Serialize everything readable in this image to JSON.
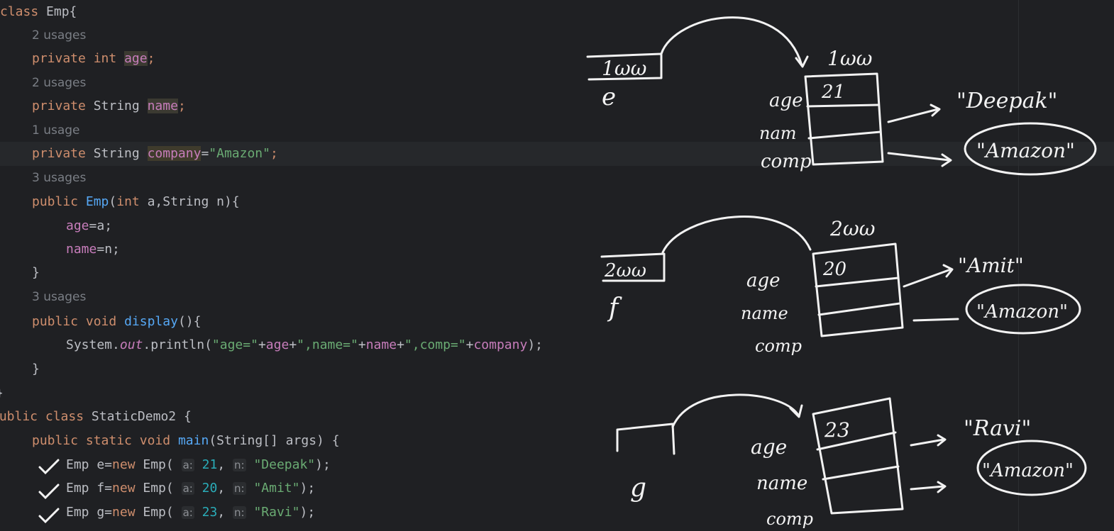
{
  "code": {
    "l1": {
      "kw": "class",
      "name": "Emp{"
    },
    "hints": {
      "u2a": "2 usages",
      "u2b": "2 usages",
      "u1": "1 usage",
      "u3a": "3 usages",
      "u3b": "3 usages"
    },
    "l3": {
      "kw1": "private",
      "kw2": "int",
      "field": "age",
      "end": ";"
    },
    "l5": {
      "kw1": "private",
      "type": "String",
      "field": "name",
      "end": ";"
    },
    "l7": {
      "kw1": "private",
      "type": "String",
      "field": "company",
      "eq": "=",
      "str": "\"Amazon\"",
      "end": ";"
    },
    "l9": {
      "kw1": "public",
      "fn": "Emp",
      "p1": "(",
      "kw2": "int",
      "p2": " a,String n){"
    },
    "l10": {
      "field": "age",
      "rest": "=a;"
    },
    "l11": {
      "field": "name",
      "rest": "=n;"
    },
    "l12": "}",
    "l14": {
      "kw1": "public",
      "kw2": "void",
      "fn": "display",
      "rest": "(){"
    },
    "l15": {
      "a": "System.",
      "out": "out",
      "b": ".println(",
      "s1": "\"age=\"",
      "op1": "+",
      "f1": "age",
      "op2": "+",
      "s2": "\",name=\"",
      "op3": "+",
      "f2": "name",
      "op4": "+",
      "s3": "\",comp=\"",
      "op5": "+",
      "f3": "company",
      "end": ");"
    },
    "l16": "}",
    "l17": "}",
    "l18": {
      "kw1": "public",
      "kw2": "class",
      "name": "StaticDemo2 {"
    },
    "l19": {
      "kw1": "public",
      "kw2": "static",
      "kw3": "void",
      "fn": "main",
      "rest": "(String[] args) {"
    },
    "l20": {
      "a": "Emp e=",
      "kw": "new",
      "b": " Emp( ",
      "pa": "a:",
      "n1": "21",
      ",": ", ",
      "pn": "n:",
      "s": "\"Deepak\"",
      "end": ");"
    },
    "l21": {
      "a": "Emp f=",
      "kw": "new",
      "b": " Emp( ",
      "pa": "a:",
      "n1": "20",
      ",": ", ",
      "pn": "n:",
      "s": "\"Amit\"",
      "end": ");"
    },
    "l22": {
      "a": "Emp g=",
      "kw": "new",
      "b": " Emp( ",
      "pa": "a:",
      "n1": "23",
      ",": ", ",
      "pn": "n:",
      "s": "\"Ravi\"",
      "end": ");"
    }
  },
  "sketch": {
    "obj1": {
      "ref": "1ωω",
      "var": "e",
      "addr": "1ωω",
      "age": "21",
      "lbl_age": "age",
      "lbl_name": "nam",
      "lbl_comp": "comp",
      "str_name": "\"Deepak\"",
      "str_comp": "\"Amazon\""
    },
    "obj2": {
      "ref": "2ωω",
      "var": "f",
      "addr": "2ωω",
      "age": "20",
      "lbl_age": "age",
      "lbl_name": "name",
      "lbl_comp": "comp",
      "str_name": "\"Amit\"",
      "str_comp": "\"Amazon\""
    },
    "obj3": {
      "var": "g",
      "age": "23",
      "lbl_age": "age",
      "lbl_name": "name",
      "lbl_comp": "comp",
      "str_name": "\"Ravi\"",
      "str_comp": "\"Amazon\""
    }
  }
}
